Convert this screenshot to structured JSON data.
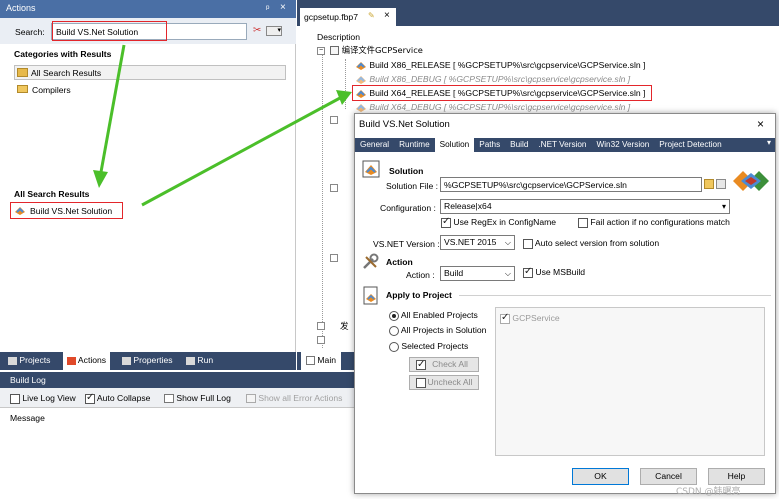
{
  "actions_panel": {
    "title": "Actions",
    "pin": "ᵖ ×",
    "search_label": "Search:",
    "search_value": "Build VS.Net Solution",
    "categories_header": "Categories with Results",
    "categories": [
      "All Search Results",
      "Compilers"
    ],
    "all_results_header": "All Search Results",
    "result_item": "Build VS.Net Solution"
  },
  "bottom_tabs": [
    "Projects",
    "Actions",
    "Properties",
    "Run"
  ],
  "build_log": {
    "title": "Build Log",
    "live_log": "Live Log View",
    "auto_collapse": "Auto Collapse",
    "show_full_log": "Show Full Log",
    "show_errors": "Show all Error Actions",
    "message_header": "Message"
  },
  "editor": {
    "tab_label": "gcpsetup.fbp7",
    "description_header": "Description",
    "tree_root": "编译文件GCPService",
    "rows": [
      "Build X86_RELEASE [ %GCPSETUP%\\src\\gcpservice\\GCPService.sln ]",
      "Build X86_DEBUG [ %GCPSETUP%\\src\\gcpservice\\gcpservice.sln ]",
      "Build X64_RELEASE [ %GCPSETUP%\\src\\gcpservice\\GCPService.sln ]",
      "Build X64_DEBUG [ %GCPSETUP%\\src\\gcpservice\\gcpservice.sln ]"
    ],
    "partial_label": "发",
    "main_tab": "Main"
  },
  "dialog": {
    "title": "Build VS.Net Solution",
    "tabs": [
      "General",
      "Runtime",
      "Solution",
      "Paths",
      "Build",
      ".NET Version",
      "Win32 Version",
      "Project Detection"
    ],
    "solution_section": "Solution",
    "solution_file_label": "Solution File :",
    "solution_file_value": "%GCPSETUP%\\src\\gcpservice\\GCPService.sln",
    "configuration_label": "Configuration :",
    "configuration_value": "Release|x64",
    "use_regex": "Use RegEx in ConfigName",
    "fail_action": "Fail action if no configurations match",
    "vsnet_label": "VS.NET Version :",
    "vsnet_value": "VS.NET 2015",
    "auto_select": "Auto select version from solution",
    "action_section": "Action",
    "action_label": "Action :",
    "action_value": "Build",
    "use_msbuild": "Use MSBuild",
    "apply_section": "Apply to Project",
    "radio_all_enabled": "All Enabled Projects",
    "radio_all_in_solution": "All Projects in Solution",
    "radio_selected": "Selected Projects",
    "check_all": "Check All",
    "uncheck_all": "Uncheck All",
    "project_item": "GCPService",
    "ok": "OK",
    "cancel": "Cancel",
    "help": "Help"
  },
  "watermark": "CSDN @韩曙亮"
}
